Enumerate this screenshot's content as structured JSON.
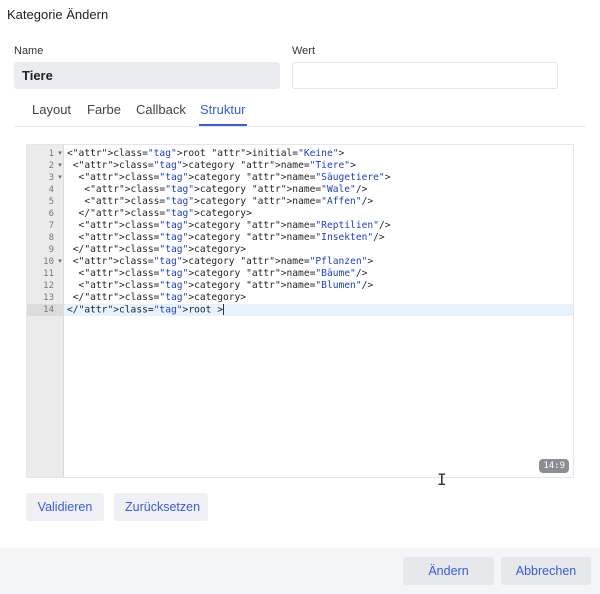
{
  "dialog": {
    "title": "Kategorie Ändern"
  },
  "form": {
    "name_label": "Name",
    "name_value": "Tiere",
    "wert_label": "Wert",
    "wert_value": ""
  },
  "tabs": [
    {
      "label": "Layout"
    },
    {
      "label": "Farbe"
    },
    {
      "label": "Callback"
    },
    {
      "label": "Struktur",
      "active": true
    }
  ],
  "editor": {
    "active_line": 14,
    "cursor_position": "14:9",
    "lines": [
      {
        "num": "1",
        "fold": true,
        "code": "<root initial=\"Keine\">"
      },
      {
        "num": "2",
        "fold": true,
        "code": " <category name=\"Tiere\">"
      },
      {
        "num": "3",
        "fold": true,
        "code": "  <category name=\"Säugetiere\">"
      },
      {
        "num": "4",
        "fold": false,
        "code": "   <category name=\"Wale\"/>"
      },
      {
        "num": "5",
        "fold": false,
        "code": "   <category name=\"Affen\"/>"
      },
      {
        "num": "6",
        "fold": false,
        "code": "  </category>"
      },
      {
        "num": "7",
        "fold": false,
        "code": "  <category name=\"Reptilien\"/>"
      },
      {
        "num": "8",
        "fold": false,
        "code": "  <category name=\"Insekten\"/>"
      },
      {
        "num": "9",
        "fold": false,
        "code": " </category>"
      },
      {
        "num": "10",
        "fold": true,
        "code": " <category name=\"Pflanzen\">"
      },
      {
        "num": "11",
        "fold": false,
        "code": "  <category name=\"Bäume\"/>"
      },
      {
        "num": "12",
        "fold": false,
        "code": "  <category name=\"Blumen\"/>"
      },
      {
        "num": "13",
        "fold": false,
        "code": " </category>"
      },
      {
        "num": "14",
        "fold": false,
        "code": "</root >"
      }
    ]
  },
  "actions": {
    "validate_label": "Validieren",
    "reset_label": "Zurücksetzen"
  },
  "footer": {
    "change_label": "Ändern",
    "cancel_label": "Abbrechen"
  },
  "colors": {
    "accent": "#3b5bdb",
    "tag": "#1e3fc7",
    "attribute": "#8e24aa"
  }
}
